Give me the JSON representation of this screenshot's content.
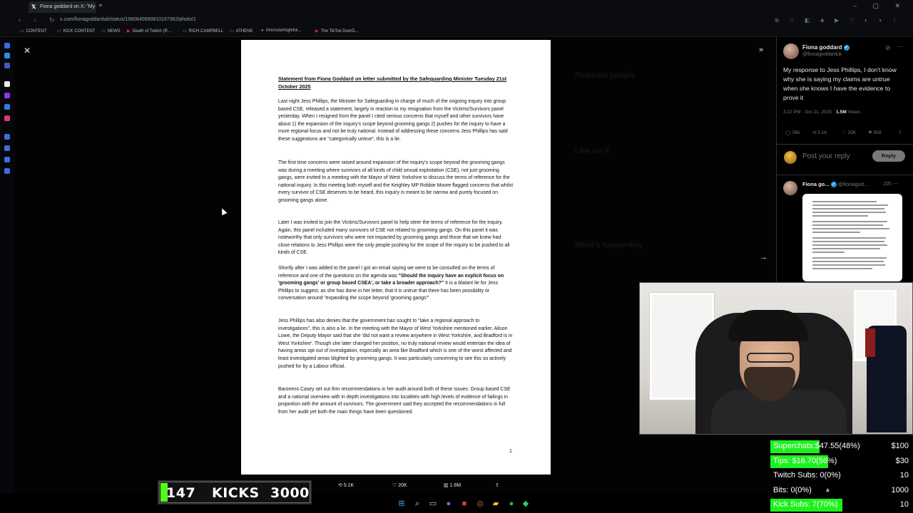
{
  "browser": {
    "tab_title": "Fiona goddard on X: \"My",
    "url": "x.com/fionagoddarduk/status/1980640890810167362/photo/1",
    "bookmarks": [
      "CONTENT",
      "KICK CONTENT",
      "NEWS",
      "Death of Twitch (R...",
      "RICH CAMPBELL",
      "ATHENE",
      "r/monsterhighdol...",
      "The TikTok DoorD..."
    ]
  },
  "document": {
    "title": "Statement from Fiona Goddard on letter submitted by the Safeguarding Minister Tuesday 21st October 2025",
    "paragraphs": [
      "Last night Jess Phillips, the Minister for Safeguarding in charge of much of the ongoing inquiry into group based CSE, released a statement, largely in reaction to my resignation from the Victims/Survivors panel yesterday. When I resigned from the panel I cited serious concerns that myself and other survivors have about 1) the expansion of the inquiry's scope beyond grooming gangs 2) pushes for the inquiry to have a more regional focus and not be truly national. Instead of addressing these concerns Jess Phillips has said these suggestions are \"categorically untrue\", this is a lie.",
      "The first time concerns were raised around expansion of the inquiry's scope beyond the grooming gangs was during a meeting where survivors of all kinds of child sexual exploitation (CSE), not just grooming gangs, were invited to a meeting with the Mayor of West Yorkshire to discuss the terms of reference for the national inquiry. In this meeting both myself and the Keighley MP Robbie Moore flagged concerns that whilst every survivor of CSE deserves to be heard, this inquiry is meant to be narrow and purely focused on grooming gangs alone.",
      "Later I was invited to join the Victims/Survivors panel to help steer the terms of reference for the inquiry. Again, this panel included many survivors of CSE not related to grooming gangs. On this panel it was noteworthy that only survivors who were not impacted by grooming gangs and those that we knew had close relations to Jess Phillips were the only people pushing for the scope of the inquiry to be pushed to all kinds of CSE.",
      "It is a blatant lie for Jess Phillips to suggest, as she has done in her letter, that it is untrue that there has been possibility or conversation around \"expanding the scope beyond 'grooming gangs'\"",
      "Jess Phillips has also denies that the government has sought to \"take a regional approach to investigations\", this is also a lie. In the meeting with the Mayor of West Yorkshire mentioned earlier, Alison Lowe, the Deputy Mayor said that she 'did not want a review anywhere in West Yorkshire, and Bradford is in West Yorkshire'. Though she later changed her position, no truly national review would entertain the idea of having areas opt out of investigation, especially an area like Bradford which is one of the worst affected and least investigated areas blighted by grooming gangs. It was particularly concerning to see this so actively pushed for by a Labour official.",
      "Baroness Casey set out firm recommendations in her audit around both of these issues. Group based CSE and a national overview with in depth investigations into localities with high levels of evidence of failings in proportion with the amount of survivors. The government said they accepted the recommendations in full from her audit yet both the main things have been questioned."
    ],
    "para4_lead": "Shortly after I was added to the panel I got an email saying we were to be consulted on the terms of reference and one of the questions on the agenda was ",
    "para4_bold": "\"Should the inquiry have an explicit focus on 'grooming gangs' or group based CSEA', or take a broader approach?\"",
    "page_number": "1"
  },
  "photo_actions": {
    "replies": "766",
    "reposts": "5.1K",
    "likes": "20K",
    "views": "1.6M"
  },
  "tweet": {
    "author": "Fiona goddard",
    "handle": "@fionagoddarduk",
    "text": "My response to Jess Phillips, I don't know why she is saying my claims are untrue when she knows I have the evidence to prove it",
    "time": "3:22 PM · Oct 21, 2025 · ",
    "views": "1.5M",
    "views_label": " Views",
    "replies": "766",
    "reposts": "5.1K",
    "likes": "20K",
    "bookmarks": "959",
    "reply_placeholder": "Post your reply",
    "reply_button": "Reply",
    "reply_author": "Fiona go...",
    "reply_handle": "@fionagod...",
    "reply_time": "· 22h"
  },
  "kicks": {
    "count": "147",
    "label": "KICKS",
    "goal": "3000",
    "progress": 0.049
  },
  "goals": [
    {
      "label": "Superchats:$47.55(48%)",
      "target": "$100",
      "fraction": 0.48,
      "color": "#1ef01e"
    },
    {
      "label": "Tips: $16.70(56%)",
      "target": "$30",
      "fraction": 0.56,
      "color": "#1ef01e"
    },
    {
      "label": "Twitch Subs:  0(0%)",
      "target": "10",
      "fraction": 0.0,
      "color": "#1ef01e"
    },
    {
      "label": "Bits:          0(0%)",
      "target": "1000",
      "fraction": 0.0,
      "color": "#1ef01e"
    },
    {
      "label": "Kick Subs:  7(70%)",
      "target": "10",
      "fraction": 0.7,
      "color": "#1ef01e"
    }
  ]
}
